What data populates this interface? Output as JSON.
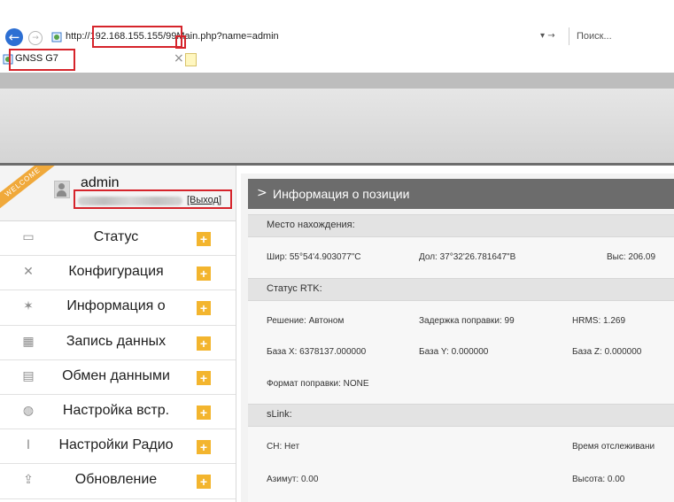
{
  "browser": {
    "url": "http://192.168.155.155/99Main.php?name=admin",
    "search_placeholder": "Поиск...",
    "tab_title": "GNSS G7",
    "tab_close": "×",
    "controls": "▾ →"
  },
  "user": {
    "welcome": "WELCOME",
    "name": "admin",
    "logout": "[Выход]"
  },
  "nav": [
    {
      "label": "Статус",
      "icon": "monitor-icon"
    },
    {
      "label": "Конфигурация",
      "icon": "tools-icon"
    },
    {
      "label": "Информация о",
      "icon": "satellite-icon"
    },
    {
      "label": "Запись данных",
      "icon": "calendar-icon"
    },
    {
      "label": "Обмен данными",
      "icon": "network-icon"
    },
    {
      "label": "Настройка встр.",
      "icon": "globe-icon"
    },
    {
      "label": "Настройки Радио",
      "icon": "antenna-icon"
    },
    {
      "label": "Обновление",
      "icon": "upload-icon"
    }
  ],
  "main": {
    "title": "Информация о позиции",
    "location": {
      "header": "Место нахождения:",
      "lat": "Шир:  55°54'4.903077\"C",
      "lon": "Дол:  37°32'26.781647\"В",
      "alt": "Выс:  206.09"
    },
    "rtk": {
      "header": "Статус RTK:",
      "solution": "Решение:  Автоном",
      "delay": "Задержка поправки:  99",
      "hrms": "HRMS:  1.269",
      "base_x": "База X:  6378137.000000",
      "base_y": "База Y:  0.000000",
      "base_z": "База Z:  0.000000",
      "format": "Формат поправки:  NONE"
    },
    "slink": {
      "header": "sLink:",
      "ch": "CH:  Нет",
      "tracking": "Время отслеживани",
      "azimuth": "Азимут:  0.00",
      "height": "Высота:  0.00"
    }
  },
  "colors": {
    "accent_red": "#d6242b",
    "plus_orange": "#f3b52e",
    "header_gray": "#6c6c6c"
  }
}
